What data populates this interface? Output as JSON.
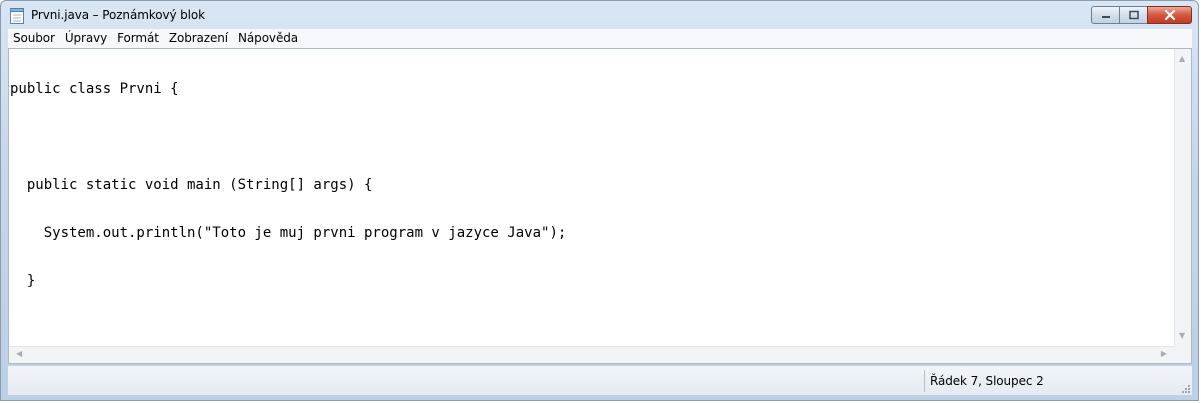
{
  "window": {
    "title": "Prvni.java – Poznámkový blok",
    "icons": {
      "app": "notepad-icon",
      "minimize": "minimize-icon",
      "maximize": "maximize-icon",
      "close": "close-icon"
    }
  },
  "menu": {
    "items": [
      {
        "label": "Soubor"
      },
      {
        "label": "Úpravy"
      },
      {
        "label": "Formát"
      },
      {
        "label": "Zobrazení"
      },
      {
        "label": "Nápověda"
      }
    ]
  },
  "editor": {
    "lines": [
      "public class Prvni {",
      "",
      "  public static void main (String[] args) {",
      "    System.out.println(\"Toto je muj prvni program v jazyce Java\");",
      "  }",
      "",
      "}"
    ]
  },
  "statusbar": {
    "position": "Řádek 7, Sloupec 2"
  },
  "colors": {
    "titlebar": "#c4d6ea",
    "close_button": "#c43b22",
    "editor_background": "#ffffff"
  }
}
